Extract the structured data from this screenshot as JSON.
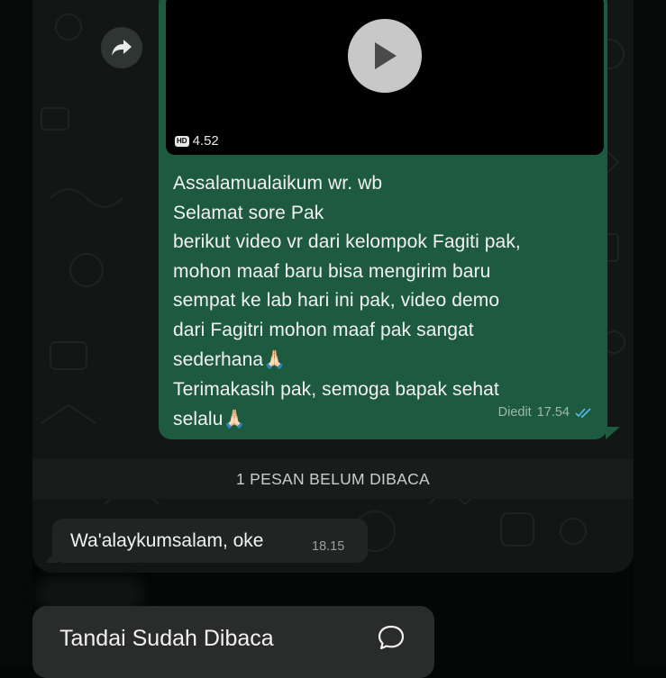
{
  "video": {
    "hd_badge": "HD",
    "duration": "4.52"
  },
  "outgoing_message": {
    "lines": [
      "Assalamualaikum wr. wb",
      "Selamat sore Pak",
      "berikut video vr dari kelompok Fagiti pak,",
      "mohon maaf baru bisa mengirim baru",
      "sempat ke lab hari ini pak, video demo",
      "dari Fagitri mohon maaf pak sangat",
      "sederhana",
      "Terimakasih pak, semoga bapak sehat",
      "selalu"
    ],
    "emoji": "🙏🏻",
    "edited_label": "Diedit",
    "time": "17.54",
    "status_icon": "double-check-read-icon"
  },
  "unread_divider": "1 PESAN BELUM DIBACA",
  "incoming_message": {
    "text": "Wa'alaykumsalam, oke",
    "time": "18.15"
  },
  "context_menu": {
    "mark_read_label": "Tandai Sudah Dibaca",
    "icon": "chat-bubble-icon"
  },
  "colors": {
    "outgoing_bubble": "#1e5a3f",
    "incoming_bubble": "#202524",
    "read_tick": "#53bdeb",
    "chat_background": "#121716"
  }
}
